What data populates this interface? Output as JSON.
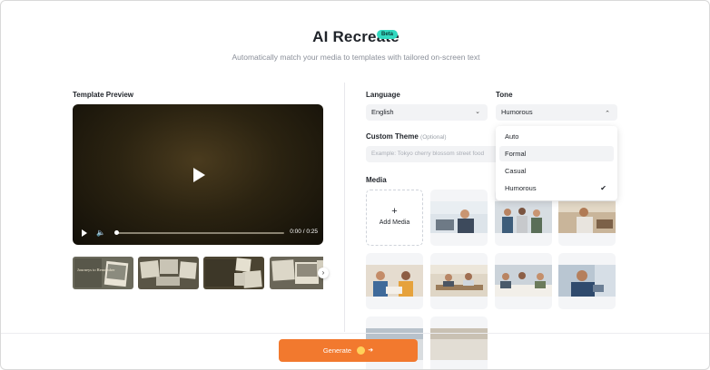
{
  "header": {
    "title": "AI Recreate",
    "badge": "Beta",
    "subtitle": "Automatically match your media to templates with tailored on-screen text"
  },
  "preview": {
    "label": "Template Preview",
    "time": "0:00 / 0:25",
    "progress": 0,
    "thumbnails": [
      {
        "caption": "Journeys to Remember"
      },
      {
        "caption": ""
      },
      {
        "caption": ""
      },
      {
        "caption": ""
      }
    ]
  },
  "language": {
    "label": "Language",
    "value": "English"
  },
  "tone": {
    "label": "Tone",
    "value": "Humorous",
    "options": [
      "Auto",
      "Formal",
      "Casual",
      "Humorous"
    ],
    "hovered": "Formal",
    "selected": "Humorous"
  },
  "custom_theme": {
    "label": "Custom Theme",
    "optional": "(Optional)",
    "placeholder": "Example: Tokyo cherry blossom street food"
  },
  "media": {
    "label": "Media",
    "add_label": "Add Media",
    "add_symbol": "+"
  },
  "footer": {
    "generate_label": "Generate",
    "accent": "#f2792e"
  },
  "icons": {
    "chevron_down": "⌄",
    "chevron_up": "⌃",
    "check": "✔",
    "next": "›",
    "volume": "🔈",
    "arrow": "➜"
  }
}
